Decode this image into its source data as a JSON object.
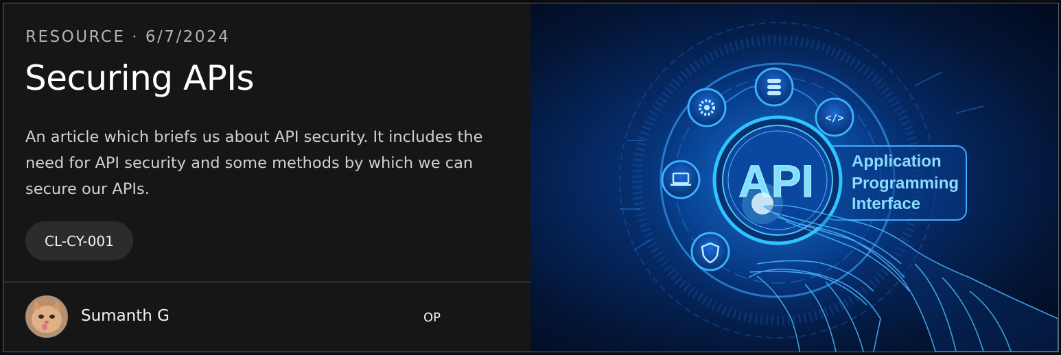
{
  "card": {
    "category": "RESOURCE",
    "separator": "·",
    "date": "6/7/2024",
    "title": "Securing APIs",
    "description": "An article which briefs us about API security. It includes the need for API security and some methods by which we can secure our APIs.",
    "tag": "CL-CY-001",
    "author": {
      "name": "Sumanth G",
      "role": "OP",
      "avatar_icon": "cat-photo-avatar"
    }
  },
  "banner": {
    "center_text": "API",
    "side_text_lines": [
      "Application",
      "Programming",
      "Interface"
    ],
    "node_icons": [
      "gear-icon",
      "database-icon",
      "code-icon",
      "laptop-icon",
      "shield-icon"
    ],
    "colors": {
      "glow": "#3fd0ff",
      "deep": "#062a66",
      "text": "#7fd8ff"
    }
  }
}
